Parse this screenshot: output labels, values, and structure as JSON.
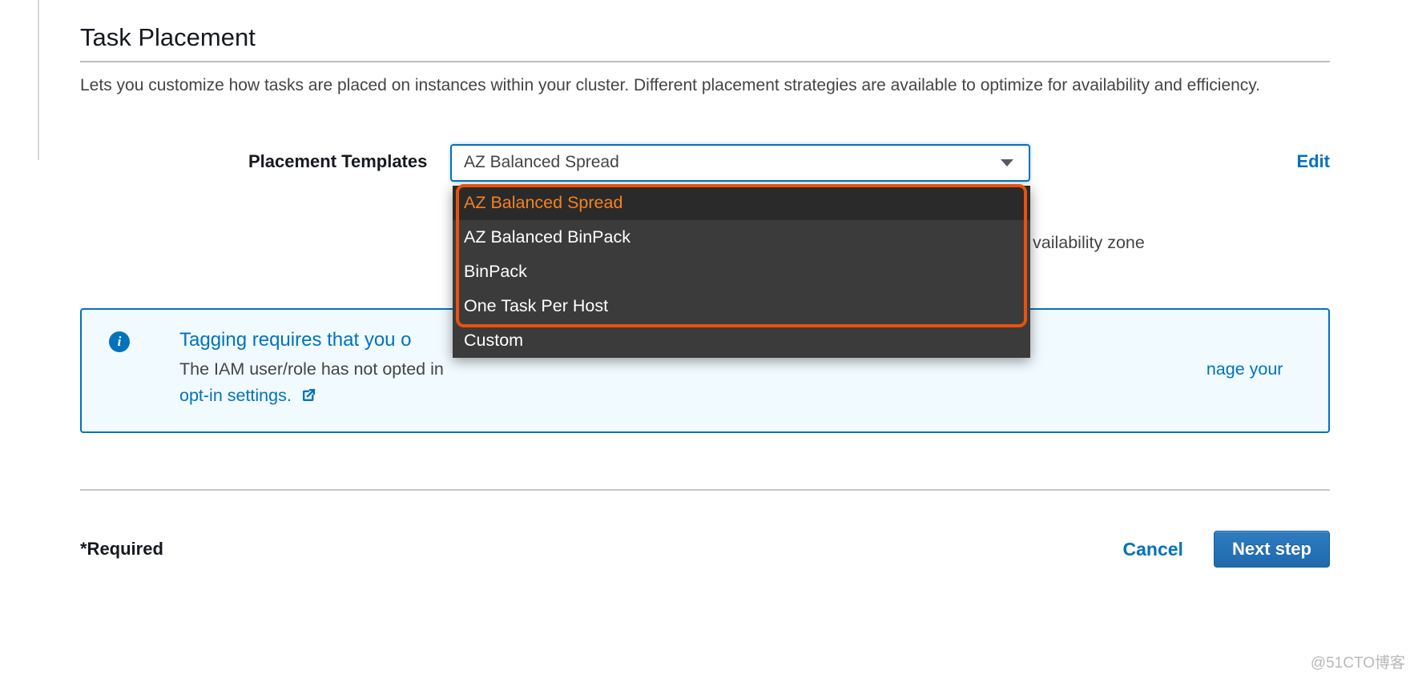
{
  "section": {
    "title": "Task Placement",
    "description": "Lets you customize how tasks are placed on instances within your cluster. Different placement strategies are available to optimize for availability and efficiency."
  },
  "placement": {
    "label": "Placement Templates",
    "selected": "AZ Balanced Spread",
    "options": [
      "AZ Balanced Spread",
      "AZ Balanced BinPack",
      "BinPack",
      "One Task Per Host",
      "Custom"
    ],
    "edit": "Edit",
    "tail_text": "vailability zone"
  },
  "info_box": {
    "title_prefix": "Tagging requires that you o",
    "body_prefix": "The IAM user/role has not opted in",
    "link_suffix": "nage your opt-in settings.",
    "link_text": "nage your opt-in settings."
  },
  "footer": {
    "required": "*Required",
    "cancel": "Cancel",
    "next": "Next step"
  },
  "watermark": "@51CTO博客"
}
